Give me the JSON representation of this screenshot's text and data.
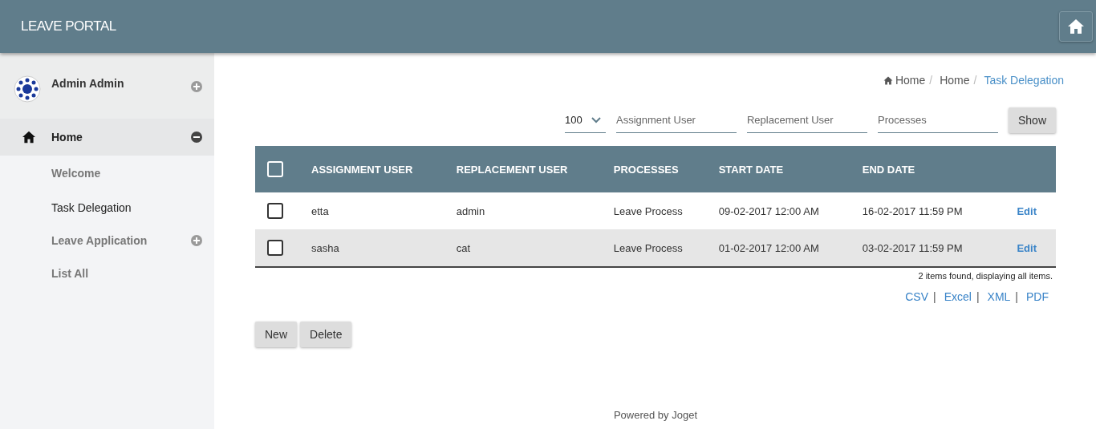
{
  "header": {
    "title": "LEAVE PORTAL"
  },
  "sidebar": {
    "user": {
      "name": "Admin Admin",
      "expanded": false
    },
    "items": [
      {
        "label": "Home",
        "expanded": true,
        "children": [
          {
            "label": "Welcome",
            "selected": false
          },
          {
            "label": "Task Delegation",
            "selected": true
          },
          {
            "label": "Leave Application",
            "selected": false,
            "expanded": false
          },
          {
            "label": "List All",
            "selected": false
          }
        ]
      }
    ]
  },
  "breadcrumb": [
    {
      "kind": "home",
      "label": "Home",
      "separator": "/"
    },
    {
      "kind": "link",
      "label": "Home",
      "separator": "/"
    },
    {
      "kind": "current",
      "label": "Task Delegation"
    }
  ],
  "filters": {
    "page_size": "100",
    "fields": [
      {
        "placeholder": "Assignment User"
      },
      {
        "placeholder": "Replacement User"
      },
      {
        "placeholder": "Processes"
      }
    ],
    "button": "Show"
  },
  "table": {
    "select_all_checked": false,
    "columns": [
      "ASSIGNMENT USER",
      "REPLACEMENT USER",
      "PROCESSES",
      "START DATE",
      "END DATE"
    ],
    "rows": [
      {
        "checked": false,
        "cells": [
          "etta",
          "admin",
          "Leave Process",
          "09-02-2017 12:00 AM",
          "16-02-2017 11:59 PM"
        ],
        "action": "Edit"
      },
      {
        "checked": false,
        "cells": [
          "sasha",
          "cat",
          "Leave Process",
          "01-02-2017 12:00 AM",
          "03-02-2017 11:59 PM"
        ],
        "action": "Edit"
      }
    ],
    "summary": "2 items found, displaying all items.",
    "exports": [
      {
        "label": "CSV",
        "separator": "|"
      },
      {
        "label": "Excel",
        "separator": "|"
      },
      {
        "label": "XML",
        "separator": "|"
      },
      {
        "label": "PDF"
      }
    ]
  },
  "buttons": [
    "New",
    "Delete"
  ],
  "footer": "Powered by Joget"
}
